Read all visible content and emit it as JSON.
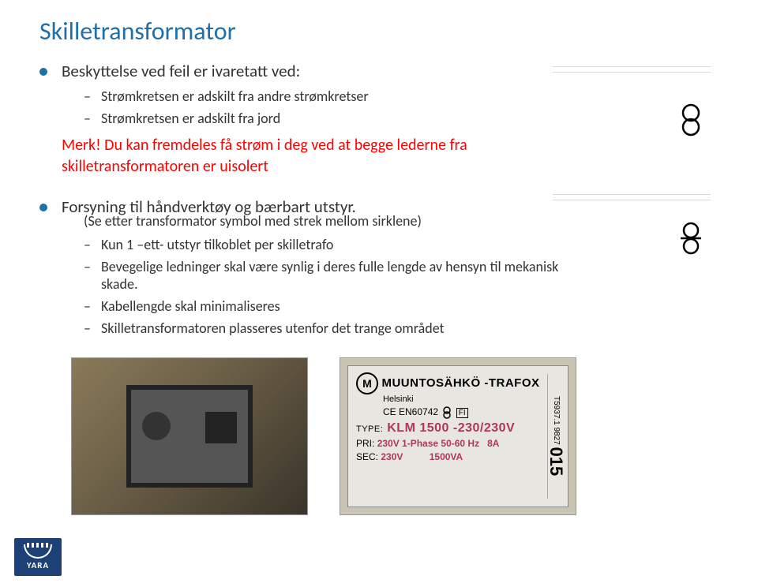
{
  "title": "Skilletransformator",
  "section1": {
    "heading": "Beskyttelse ved feil er ivaretatt ved:",
    "items": [
      "Strømkretsen er adskilt fra andre strømkretser",
      "Strømkretsen er adskilt fra jord"
    ],
    "merk": "Merk! Du kan fremdeles få strøm i deg ved at begge lederne fra skilletransformatoren er uisolert"
  },
  "section2": {
    "heading": "Forsyning til håndverktøy og bærbart utstyr.",
    "note": "(Se etter transformator symbol med strek mellom sirklene)",
    "items": [
      "Kun 1 –ett- utstyr tilkoblet per skilletrafo",
      "Bevegelige ledninger skal være synlig i deres fulle lengde av hensyn til mekanisk skade.",
      "Kabellengde skal minimaliseres",
      "Skilletransformatoren plasseres utenfor det trange området"
    ]
  },
  "label_plate": {
    "brand": "MUUNTOSÄHKÖ -TRAFOX",
    "city": "Helsinki",
    "cert": "CE  EN60742",
    "type_label": "TYPE:",
    "type_value": "KLM 1500 -230/230V",
    "pri_label": "PRI:",
    "pri_value": "230V 1-Phase 50-60 Hz",
    "pri_amp": "8A",
    "sec_label": "SEC:",
    "sec_value": "230V",
    "sec_va": "1500VA",
    "side_code": "T5937.1 9827",
    "side_num": "015"
  },
  "logo": {
    "text": "YARA"
  }
}
